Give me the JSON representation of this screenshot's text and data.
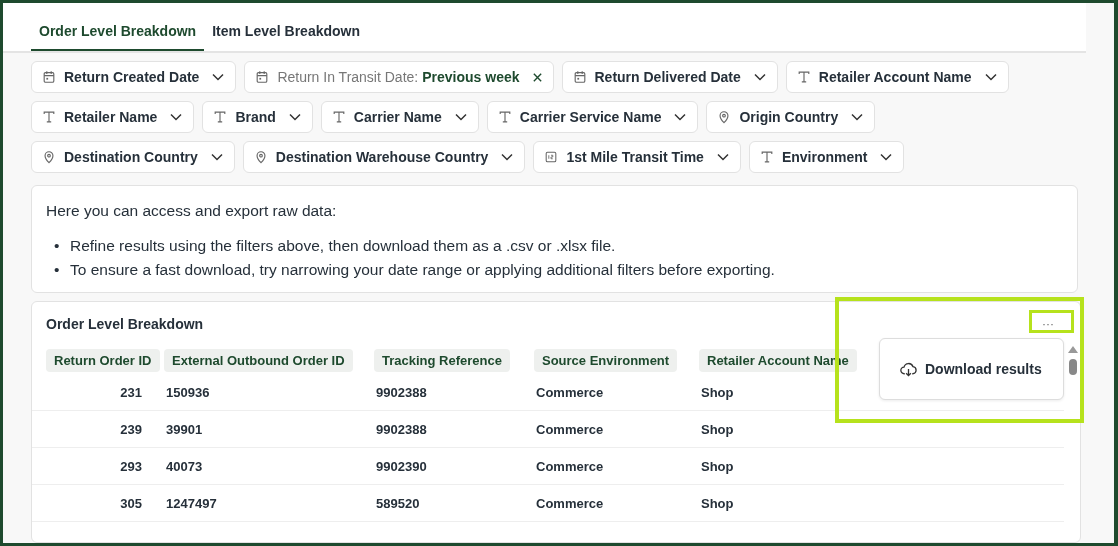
{
  "tabs": [
    {
      "label": "Order Level Breakdown",
      "selected": true
    },
    {
      "label": "Item Level Breakdown",
      "selected": false
    }
  ],
  "filters": [
    [
      {
        "kind": "date",
        "label": "Return Created Date",
        "active": false
      },
      {
        "kind": "date",
        "label": "Return In Transit Date:",
        "value": "Previous week",
        "active": true
      },
      {
        "kind": "date",
        "label": "Return Delivered Date",
        "active": false
      },
      {
        "kind": "text",
        "label": "Retailer Account Name",
        "active": false
      }
    ],
    [
      {
        "kind": "text",
        "label": "Retailer Name",
        "active": false
      },
      {
        "kind": "text",
        "label": "Brand",
        "active": false
      },
      {
        "kind": "text",
        "label": "Carrier Name",
        "active": false
      },
      {
        "kind": "text",
        "label": "Carrier Service Name",
        "active": false
      },
      {
        "kind": "location",
        "label": "Origin Country",
        "active": false
      }
    ],
    [
      {
        "kind": "location",
        "label": "Destination Country",
        "active": false
      },
      {
        "kind": "location",
        "label": "Destination Warehouse Country",
        "active": false
      },
      {
        "kind": "number",
        "label": "1st Mile Transit Time",
        "active": false
      },
      {
        "kind": "text",
        "label": "Environment",
        "active": false
      }
    ]
  ],
  "info": {
    "intro": "Here you can access and export raw data:",
    "bullets": [
      {
        "marker": "•",
        "text": "Refine results using the filters above, then download them as a .csv or .xlsx file."
      },
      {
        "marker": "•",
        "text": "To ensure a fast download, try narrowing your date range or applying additional filters before exporting."
      }
    ]
  },
  "table": {
    "title": "Order Level Breakdown",
    "menu_button": "···",
    "columns": [
      "Return Order ID",
      "External Outbound Order ID",
      "Tracking Reference",
      "Source Environment",
      "Retailer Account Name"
    ],
    "rows": [
      [
        "231",
        "150936",
        "9902388",
        "Commerce",
        "Shop"
      ],
      [
        "239",
        "39901",
        "9902388",
        "Commerce",
        "Shop"
      ],
      [
        "293",
        "40073",
        "9902390",
        "Commerce",
        "Shop"
      ],
      [
        "305",
        "1247497",
        "589520",
        "Commerce",
        "Shop"
      ]
    ],
    "menu": {
      "items": [
        "Download results"
      ]
    }
  }
}
